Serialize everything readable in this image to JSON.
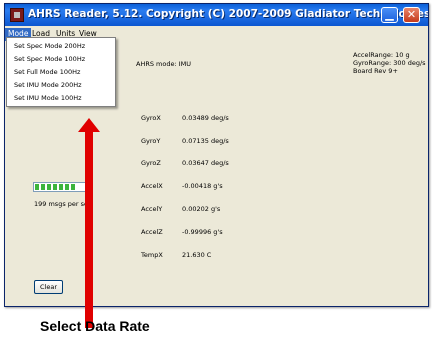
{
  "window": {
    "title": "AHRS Reader, 5.12.  Copyright (C) 2007-2009 Gladiator Technologies, Inc.",
    "minimize_glyph": "▁",
    "close_glyph": "✕"
  },
  "menu": {
    "items": [
      "Mode",
      "Load",
      "Units",
      "View"
    ],
    "active": "Mode"
  },
  "mode_dropdown": [
    "Set Spec Mode 200Hz",
    "Set Spec Mode 100Hz",
    "Set Full Mode 100Hz",
    "Set IMU Mode 200Hz",
    "Set IMU Mode 100Hz"
  ],
  "status": {
    "mode_text": "AHRS mode: IMU",
    "accel_range": "AccelRange:  10 g",
    "gyro_range": "GyroRange:  300 deg/s",
    "board_rev": "Board Rev 9+",
    "msgs_per_sec": "199  msgs per second"
  },
  "progress": {
    "fraction": 0.72
  },
  "readings": [
    {
      "label": "GyroX",
      "value": "0.03489  deg/s"
    },
    {
      "label": "GyroY",
      "value": "0.07135  deg/s"
    },
    {
      "label": "GyroZ",
      "value": "0.03647  deg/s"
    },
    {
      "label": "AccelX",
      "value": "-0.00418  g's"
    },
    {
      "label": "AccelY",
      "value": "0.00202  g's"
    },
    {
      "label": "AccelZ",
      "value": "-0.99996  g's"
    },
    {
      "label": "TempX",
      "value": "21.630  C"
    }
  ],
  "buttons": {
    "clear": "Clear"
  },
  "annotation": {
    "caption": "Select Data Rate",
    "arrow_color": "#e00000"
  }
}
